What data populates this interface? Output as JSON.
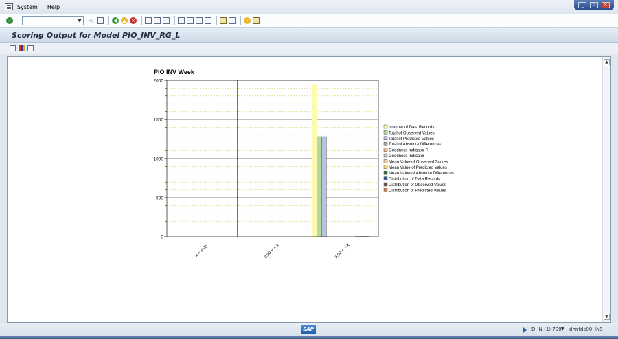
{
  "menu": {
    "items": [
      "System",
      "Help"
    ]
  },
  "title": "Scoring Output for Model PIO_INV_RG_L",
  "status": {
    "system": "DHN (1) 700",
    "server": "dhntdc00",
    "mode": "INS",
    "logo": "SAP"
  },
  "icons": {
    "toolbar": [
      "enter-icon",
      "back-icon",
      "save-icon",
      "green-back-icon",
      "yellow-exit-icon",
      "red-cancel-icon",
      "print-icon",
      "find-icon",
      "find-next-icon",
      "first-page-icon",
      "previous-page-icon",
      "next-page-icon",
      "last-page-icon",
      "create-session-icon",
      "shortcut-icon",
      "help-icon",
      "customize-layout-icon"
    ],
    "app_toolbar": [
      "chart-settings-icon",
      "chart-type-icon",
      "zoom-icon"
    ]
  },
  "chart_data": {
    "type": "bar",
    "title": "PIO INV Week",
    "categories": [
      "X < 0.00",
      "0.00 < = X",
      "0.00 < = X"
    ],
    "ylim": [
      0,
      2000
    ],
    "yticks": [
      0,
      500,
      1000,
      1500,
      2000
    ],
    "grid": true,
    "legend_position": "right",
    "series": [
      {
        "name": "Number of Data Records",
        "color": "#fdfbb0",
        "values": [
          0,
          0,
          1950
        ]
      },
      {
        "name": "Total of Observed Values",
        "color": "#b8d8a0",
        "values": [
          0,
          0,
          1280
        ]
      },
      {
        "name": "Total of Predicted Values",
        "color": "#b4c4e4",
        "values": [
          0,
          0,
          1280
        ]
      },
      {
        "name": "Total of Absolute Differences",
        "color": "#a8a8a8",
        "values": [
          0,
          0,
          0
        ]
      },
      {
        "name": "Goodness Indicator R",
        "color": "#f0b890",
        "values": [
          0,
          0,
          0
        ]
      },
      {
        "name": "Goodness Indicator I",
        "color": "#c0c0c0",
        "values": [
          0,
          0,
          0
        ]
      },
      {
        "name": "Mean Value of Observed Scores",
        "color": "#f4c8a8",
        "values": [
          0,
          0,
          0
        ]
      },
      {
        "name": "Mean Value of Predicted Values",
        "color": "#f0e07c",
        "values": [
          0,
          0,
          0
        ]
      },
      {
        "name": "Mean Value of Absolute Differences",
        "color": "#2e6e3c",
        "values": [
          0,
          0,
          0
        ]
      },
      {
        "name": "Distribution of Data Records",
        "color": "#3a5a9a",
        "values": [
          0,
          0,
          4
        ]
      },
      {
        "name": "Distribution of Observed Values",
        "color": "#6a5040",
        "values": [
          0,
          0,
          4
        ]
      },
      {
        "name": "Distribution of Predicted Values",
        "color": "#e07840",
        "values": [
          0,
          0,
          4
        ]
      }
    ]
  }
}
